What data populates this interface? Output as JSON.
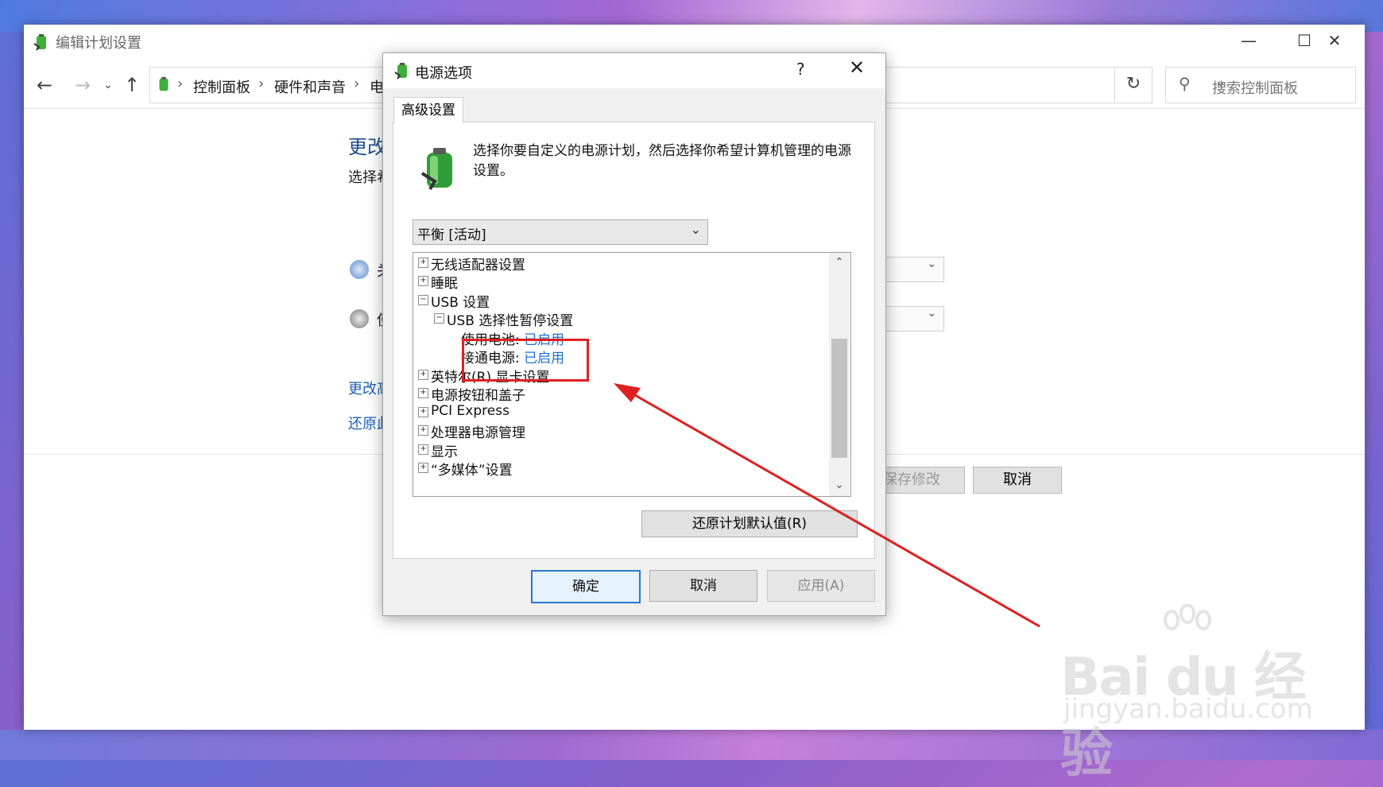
{
  "main_window": {
    "title": "编辑计划设置",
    "minimize_icon": "minimize-icon",
    "maximize_icon": "maximize-icon",
    "close_icon": "close-icon"
  },
  "address_bar": {
    "crumbs": [
      "控制面板",
      "硬件和声音",
      "电"
    ],
    "search_placeholder": "搜索控制面板"
  },
  "background_page": {
    "heading": "更改",
    "subtitle": "选择希",
    "row1_label": "关",
    "row2_label": "使",
    "link1": "更改高",
    "link2": "还原此",
    "save_btn": "保存修改",
    "cancel_btn": "取消"
  },
  "dialog": {
    "title": "电源选项",
    "help": "?",
    "tab": "高级设置",
    "intro": "选择你要自定义的电源计划，然后选择你希望计算机管理的电源设置。",
    "plan": "平衡 [活动]",
    "tree": {
      "items": [
        {
          "expander": "+",
          "label": "无线适配器设置"
        },
        {
          "expander": "+",
          "label": "睡眠"
        },
        {
          "expander": "−",
          "label": "USB 设置"
        },
        {
          "expander": "−",
          "label": "USB 选择性暂停设置"
        },
        {
          "label": "使用电池:",
          "value": "已启用"
        },
        {
          "label": "接通电源:",
          "value": "已启用"
        },
        {
          "expander": "+",
          "label": "英特尔(R) 显卡设置"
        },
        {
          "expander": "+",
          "label": "电源按钮和盖子"
        },
        {
          "expander": "+",
          "label": "PCI Express"
        },
        {
          "expander": "+",
          "label": "处理器电源管理"
        },
        {
          "expander": "+",
          "label": "显示"
        },
        {
          "expander": "+",
          "label": "“多媒体”设置"
        }
      ]
    },
    "restore_btn": "还原计划默认值(R)",
    "ok_btn": "确定",
    "cancel_btn": "取消",
    "apply_btn": "应用(A)"
  },
  "watermark": {
    "brand": "Bai du 经验",
    "url": "jingyan.baidu.com"
  },
  "colors": {
    "annotation": "#e02020",
    "link": "#1f6fd0",
    "heading": "#1e4e8c"
  }
}
